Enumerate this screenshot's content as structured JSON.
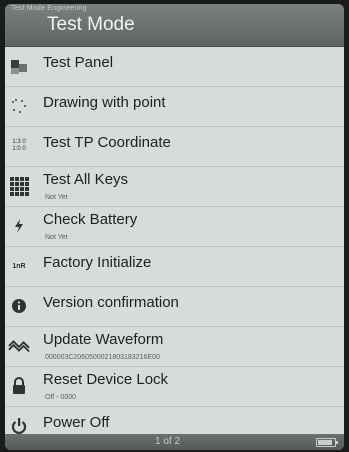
{
  "header": {
    "tiny_text": "Test Mode Engineering",
    "title": "Test Mode"
  },
  "menu": {
    "items": [
      {
        "label": "Test Panel",
        "sub": "",
        "icon": "panel-icon"
      },
      {
        "label": "Drawing with point",
        "sub": "",
        "icon": "drawing-icon"
      },
      {
        "label": "Test TP Coordinate",
        "sub": "",
        "icon": "coordinate-icon"
      },
      {
        "label": "Test All Keys",
        "sub": "Not Yet",
        "icon": "keys-grid-icon"
      },
      {
        "label": "Check Battery",
        "sub": "Not Yet",
        "icon": "battery-icon"
      },
      {
        "label": "Factory Initialize",
        "sub": "",
        "icon": "factory-reset-icon"
      },
      {
        "label": "Version confirmation",
        "sub": "",
        "icon": "info-icon"
      },
      {
        "label": "Update Waveform",
        "sub": "000003C2060500021803183216E00",
        "icon": "waveform-icon"
      },
      {
        "label": "Reset Device Lock",
        "sub": "Off - 0000",
        "icon": "lock-icon"
      },
      {
        "label": "Power Off",
        "sub": "",
        "icon": "power-icon"
      }
    ]
  },
  "footer": {
    "page_indicator": "1 of 2"
  },
  "icons": {
    "coordinate_text": "1:3 0\n1:0 0",
    "factory_text": "1nR"
  }
}
